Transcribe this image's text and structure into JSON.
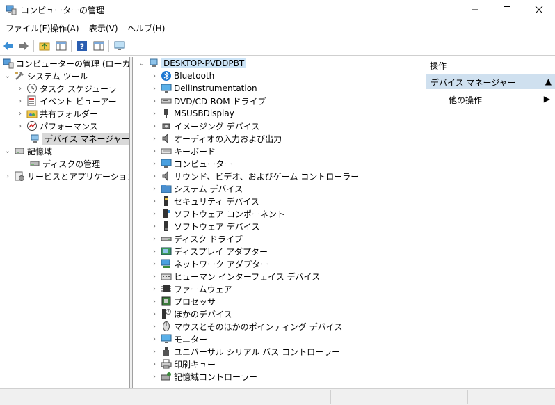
{
  "window": {
    "title": "コンピューターの管理"
  },
  "menu": [
    "ファイル(F)",
    "操作(A)",
    "表示(V)",
    "ヘルプ(H)"
  ],
  "left_tree": {
    "root": "コンピューターの管理 (ローカル)",
    "system_tools": "システム ツール",
    "system_children": [
      "タスク スケジューラ",
      "イベント ビューアー",
      "共有フォルダー",
      "パフォーマンス",
      "デバイス マネージャー"
    ],
    "storage": "記憶域",
    "storage_children": [
      "ディスクの管理"
    ],
    "services": "サービスとアプリケーション"
  },
  "device_tree": {
    "root": "DESKTOP-PVDDPBT",
    "categories": [
      {
        "label": "Bluetooth",
        "icon": "bluetooth-icon"
      },
      {
        "label": "DellInstrumentation",
        "icon": "monitor-icon"
      },
      {
        "label": "DVD/CD-ROM ドライブ",
        "icon": "dvd-drive-icon"
      },
      {
        "label": "MSUSBDisplay",
        "icon": "usb-display-icon"
      },
      {
        "label": "イメージング デバイス",
        "icon": "camera-icon"
      },
      {
        "label": "オーディオの入力および出力",
        "icon": "speaker-icon"
      },
      {
        "label": "キーボード",
        "icon": "keyboard-icon"
      },
      {
        "label": "コンピューター",
        "icon": "computer-icon"
      },
      {
        "label": "サウンド、ビデオ、およびゲーム コントローラー",
        "icon": "speaker-icon"
      },
      {
        "label": "システム デバイス",
        "icon": "folder-icon"
      },
      {
        "label": "セキュリティ デバイス",
        "icon": "security-key-icon"
      },
      {
        "label": "ソフトウェア コンポーネント",
        "icon": "component-icon"
      },
      {
        "label": "ソフトウェア デバイス",
        "icon": "device-icon"
      },
      {
        "label": "ディスク ドライブ",
        "icon": "disk-drive-icon"
      },
      {
        "label": "ディスプレイ アダプター",
        "icon": "display-adapter-icon"
      },
      {
        "label": "ネットワーク アダプター",
        "icon": "network-icon"
      },
      {
        "label": "ヒューマン インターフェイス デバイス",
        "icon": "hid-icon"
      },
      {
        "label": "ファームウェア",
        "icon": "chip-icon"
      },
      {
        "label": "プロセッサ",
        "icon": "processor-icon"
      },
      {
        "label": "ほかのデバイス",
        "icon": "unknown-device-icon"
      },
      {
        "label": "マウスとそのほかのポインティング デバイス",
        "icon": "mouse-icon"
      },
      {
        "label": "モニター",
        "icon": "monitor-icon"
      },
      {
        "label": "ユニバーサル シリアル バス コントローラー",
        "icon": "usb-icon"
      },
      {
        "label": "印刷キュー",
        "icon": "printer-icon"
      },
      {
        "label": "記憶域コントローラー",
        "icon": "storage-controller-icon"
      }
    ]
  },
  "actions": {
    "header": "操作",
    "section": "デバイス マネージャー",
    "item": "他の操作"
  },
  "colors": {
    "accent": "#0078d7",
    "selection": "#cce4f7",
    "action_title_bg": "#cfe0ef"
  }
}
